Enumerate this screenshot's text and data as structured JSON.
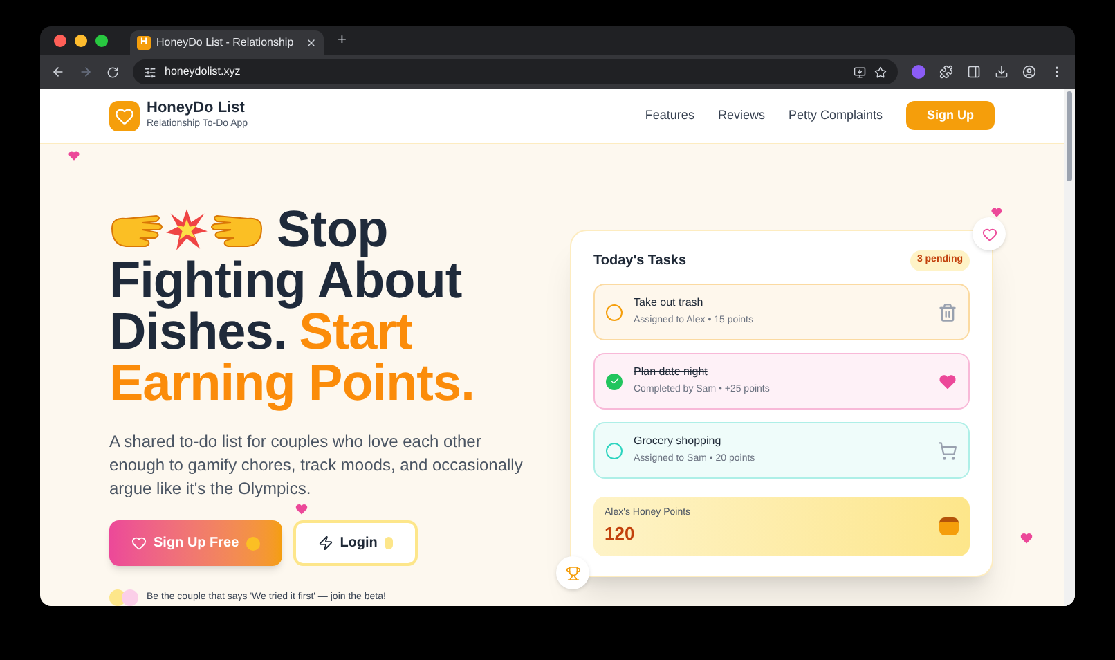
{
  "browser": {
    "tab_title": "HoneyDo List - Relationship",
    "tab_badge": "H",
    "url": "honeydolist.xyz",
    "new_tab": "+"
  },
  "nav": {
    "brand": "HoneyDo List",
    "tagline": "Relationship To-Do App",
    "links": [
      "Features",
      "Reviews",
      "Petty Complaints"
    ],
    "cta": "Sign Up"
  },
  "hero": {
    "headline_lines": [
      {
        "with_emoji": true,
        "parts": [
          {
            "text": "Stop",
            "accent": false
          }
        ]
      },
      {
        "with_emoji": false,
        "parts": [
          {
            "text": "Fighting About",
            "accent": false
          }
        ]
      },
      {
        "with_emoji": false,
        "parts": [
          {
            "text": "Dishes.",
            "accent": false
          },
          {
            "text": "Start",
            "accent": true
          }
        ]
      },
      {
        "with_emoji": false,
        "parts": [
          {
            "text": "Earning Points.",
            "accent": true
          }
        ]
      }
    ],
    "description": "A shared to-do list for couples who love each other enough to gamify chores, track moods, and occasionally argue like it's the Olympics.",
    "primary_button": "Sign Up Free",
    "secondary_button": "Login",
    "beta_note": "Be the couple that says 'We tried it first' — join the beta!"
  },
  "tasks_card": {
    "title": "Today's Tasks",
    "badge": "3 pending",
    "tasks": [
      {
        "title": "Take out trash",
        "detail": "Assigned to Alex • 15 points",
        "done": false,
        "color": "#f59e0b",
        "kind": "trash"
      },
      {
        "title": "Plan date night",
        "detail": "Completed by Sam • +25 points",
        "done": true,
        "color": "#ec4899",
        "kind": "hearts"
      },
      {
        "title": "Grocery shopping",
        "detail": "Assigned to Sam • 20 points",
        "done": false,
        "color": "#2dd4bf",
        "kind": "cart"
      }
    ],
    "points_label": "Alex's Honey Points",
    "points_value": "120"
  }
}
